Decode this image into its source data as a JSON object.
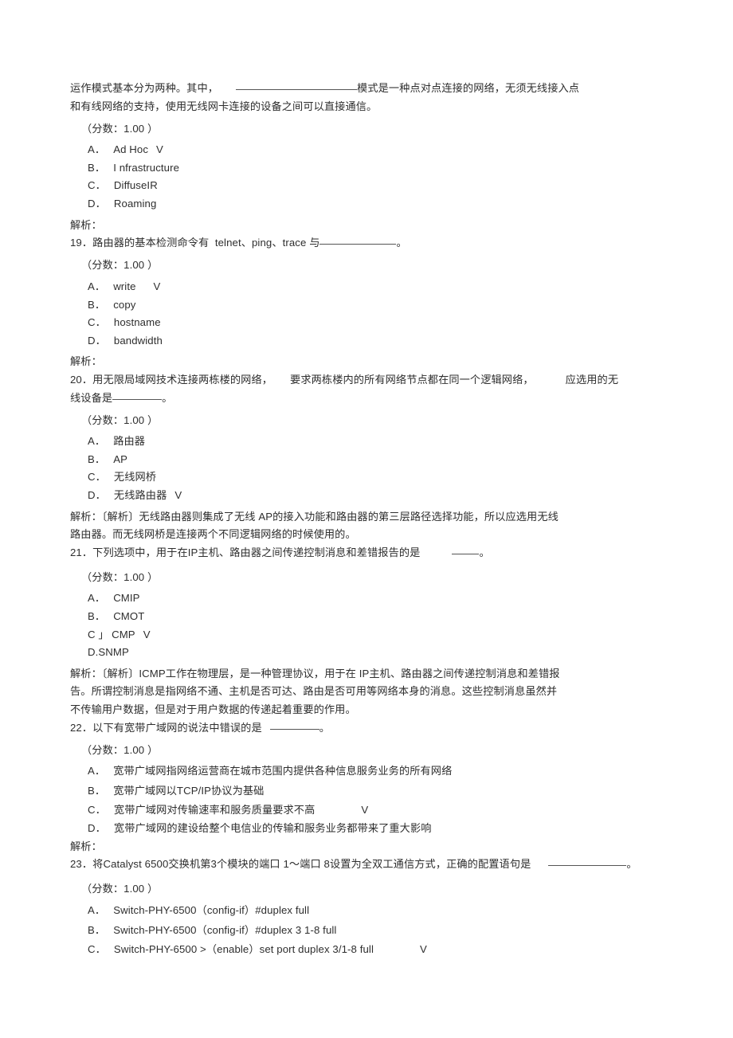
{
  "document": {
    "type": "exam-question-sheet",
    "text_color": "#2e2e2e",
    "background_color": "#ffffff",
    "answer_mark": "V",
    "score_label": "（分数：1.00 ）",
    "analysis_label": "解析："
  },
  "questions": [
    {
      "id": "q18-partial",
      "stem_lines": [
        "运作模式基本分为两种。其中，",
        "模式是一种点对点连接的网络，无须无线接入点",
        "和有线网络的支持，使用无线网卡连接的设备之间可以直接通信。"
      ],
      "score": "（分数：1.00 ）",
      "options": [
        {
          "label": "A．",
          "text": "Ad Hoc",
          "mark": "V"
        },
        {
          "label": "B．",
          "text": "I nfrastructure",
          "mark": ""
        },
        {
          "label": "C．",
          "text": "DiffuseIR",
          "mark": ""
        },
        {
          "label": "D．",
          "text": "Roaming",
          "mark": ""
        }
      ],
      "analysis": "解析："
    },
    {
      "id": "q19",
      "number": "19．",
      "stem_pre": "路由器的基本检测命令有  telnet、ping、trace 与",
      "stem_post": "。",
      "score": "（分数：1.00 ）",
      "options": [
        {
          "label": "A．",
          "text": "write",
          "mark": "V"
        },
        {
          "label": "B．",
          "text": "copy",
          "mark": ""
        },
        {
          "label": "C．",
          "text": "hostname",
          "mark": ""
        },
        {
          "label": "D．",
          "text": "bandwidth",
          "mark": ""
        }
      ],
      "analysis": "解析："
    },
    {
      "id": "q20",
      "number": "20．",
      "stem_line1_a": "用无限局域网技术连接两栋楼的网络，",
      "stem_line1_b": "要求两栋楼内的所有网络节点都在同一个逻辑网络，",
      "stem_line1_c": "应选用的无",
      "stem_line2_pre": "线设备是",
      "stem_line2_post": "。",
      "score": "（分数：1.00 ）",
      "options": [
        {
          "label": "A．",
          "text": "路由器",
          "mark": ""
        },
        {
          "label": "B．",
          "text": "AP",
          "mark": ""
        },
        {
          "label": "C．",
          "text": "无线网桥",
          "mark": ""
        },
        {
          "label": "D．",
          "text": "无线路由器",
          "mark": "V"
        }
      ],
      "analysis_lines": [
        "解析：〔解析〕无线路由器则集成了无线 AP的接入功能和路由器的第三层路径选择功能，所以应选用无线",
        "路由器。而无线网桥是连接两个不同逻辑网络的时候使用的。"
      ]
    },
    {
      "id": "q21",
      "number": "21．",
      "stem_pre": "下列选项中，用于在IP主机、路由器之间传递控制消息和差错报告的是",
      "stem_post": "。",
      "score": "（分数：1.00 ）",
      "options": [
        {
          "label": "A．",
          "text": "CMIP",
          "mark": ""
        },
        {
          "label": "B．",
          "text": "CMOT",
          "mark": ""
        },
        {
          "label": "C ｣",
          "text": "CMP",
          "mark": "V"
        },
        {
          "label": "D.",
          "text": "SNMP",
          "mark": ""
        }
      ],
      "analysis_lines": [
        "解析：〔解析〕ICMP工作在物理层，是一种管理协议，用于在 IP主机、路由器之间传递控制消息和差错报",
        "告。所谓控制消息是指网络不通、主机是否可达、路由是否可用等网络本身的消息。这些控制消息虽然并",
        "不传输用户数据，但是对于用户数据的传递起着重要的作用。"
      ]
    },
    {
      "id": "q22",
      "number": "22．",
      "stem_pre": "以下有宽带广域网的说法中错误的是",
      "stem_post": "。",
      "score": "（分数：1.00 ）",
      "options": [
        {
          "label": "A．",
          "text": "宽带广域网指网络运营商在城市范围内提供各种信息服务业务的所有网络",
          "mark": ""
        },
        {
          "label": "B．",
          "text": "宽带广域网以TCP/IP协议为基础",
          "mark": ""
        },
        {
          "label": "C．",
          "text": "宽带广域网对传输速率和服务质量要求不高",
          "mark": "V"
        },
        {
          "label": "D．",
          "text": "宽带广域网的建设给整个电信业的传输和服务业务都带来了重大影响",
          "mark": ""
        }
      ],
      "analysis": "解析："
    },
    {
      "id": "q23",
      "number": "23．",
      "stem_pre": "将Catalyst 6500交换机第3个模块的端口 1～端口 8设置为全双工通信方式，正确的配置语句是",
      "stem_post": "。",
      "score": "（分数：1.00 ）",
      "options": [
        {
          "label": "A．",
          "text": "Switch-PHY-6500（config-if）#duplex full",
          "mark": ""
        },
        {
          "label": "B．",
          "text": "Switch-PHY-6500（config-if）#duplex 3 1-8 full",
          "mark": ""
        },
        {
          "label": "C．",
          "text": "Switch-PHY-6500 >（enable）set port duplex 3/1-8 full",
          "mark": "V"
        }
      ]
    }
  ]
}
